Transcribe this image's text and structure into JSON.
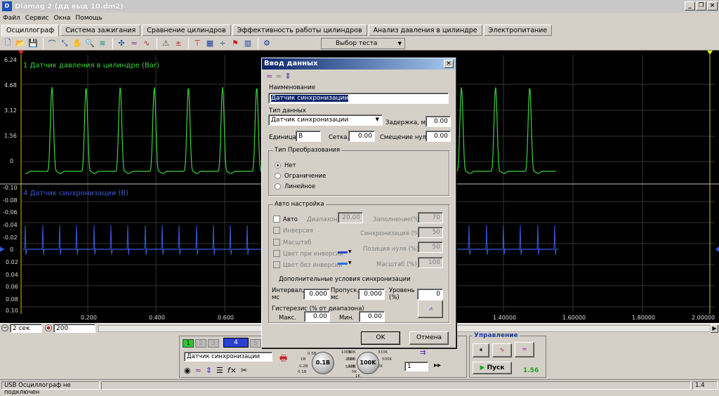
{
  "window": {
    "title": "Diamag 2 (дд выд 10.dm2)",
    "app_icon": "D"
  },
  "menu": [
    "Файл",
    "Сервис",
    "Окна",
    "Помощь"
  ],
  "tabs": [
    "Осциллограф",
    "Система зажигания",
    "Сравнение цилиндров",
    "Эффективность работы цилиндров",
    "Анализ давления в цилиндре",
    "Электропитание"
  ],
  "toolbar": {
    "test_select": "Выбор теста"
  },
  "plot": {
    "ch1_label": "1 Датчик давления в цилиндре (Bar)",
    "ch1_color": "#3ad33a",
    "ch4_label": "4 Датчик синхронизации (В)",
    "ch4_color": "#3a5be0",
    "ch1_ticks": [
      "6.24",
      "4.68",
      "3.12",
      "1.56",
      "0"
    ],
    "ch4_ticks": [
      "-0.10",
      "-0.08",
      "-0.06",
      "-0.04",
      "-0.02",
      "0",
      "0.02",
      "0.04",
      "0.06",
      "0.08",
      "0.10"
    ],
    "x_ticks": [
      "0.200",
      "0.400",
      "0.600",
      "1.40000",
      "1.60000",
      "1.80000",
      "2.00000"
    ]
  },
  "dialog": {
    "title": "Ввод данных",
    "name_label": "Наименование",
    "name_value": "Датчик синхронизации",
    "type_label": "Тип данных",
    "type_value": "Датчик синхронизации",
    "delay_label": "Задержка, мс",
    "delay_value": "0.00",
    "unit_label": "Единица.",
    "unit_value": "В",
    "grid_label": "Сетка.",
    "grid_value": "0.00",
    "zero_label": "Смещение нуля",
    "zero_value": "0.00",
    "conv_group": "Тип Преобразования",
    "conv_options": [
      "Нет",
      "Ограничение",
      "Линейное"
    ],
    "auto_group": "Авто настройка",
    "auto_label": "Авто",
    "range_label": "Диапазон.",
    "range_value": "20.00",
    "inversion_label": "Инверсия",
    "scale_label": "Масштаб",
    "color_inv_label": "Цвет при инверсии",
    "color_noinv_label": "Цвет без инверсии",
    "fill_label": "Заполнение(%)",
    "fill_value": "70",
    "sync_label": "Синхронизация (%)",
    "sync_value": "50",
    "zeropos_label": "Позиция нуля (%)",
    "zeropos_value": "50",
    "scalepct_label": "Масштаб (%)",
    "scalepct_value": "100",
    "extra_label": "Дополнительные условия синхронизации",
    "interval_label": "Интервал, мс",
    "interval_value": "0.000",
    "skip_label": "Пропуск, мс",
    "skip_value": "0.000",
    "level_label": "Уровень (%)",
    "level_value": "0",
    "hyst_label": "Гистерезис (% от диапазона)",
    "max_label": "Макс.",
    "max_value": "0.00",
    "min_label": "Мин.",
    "min_value": "0.00",
    "ok_label": "OK",
    "cancel_label": "Отмена"
  },
  "bottom": {
    "time_value": "2 сек",
    "points_value": "200"
  },
  "panel": {
    "channels": [
      "1",
      "2",
      "3",
      "4",
      "5"
    ],
    "sensor_value": "Датчик синхронизации",
    "knob1": "0.1В",
    "knob1_marks": [
      "10B",
      "20B",
      "50B",
      "100B",
      "200B",
      "500B",
      "1B",
      "0.1B",
      "0.2B",
      "0.5B"
    ],
    "knob2": "100K",
    "knob2_marks": [
      "100K",
      "200K",
      "333K",
      "500K",
      "50K",
      "20K",
      "10K",
      "5K",
      "2K",
      "1K"
    ],
    "spin_value": "1",
    "control_label": "Управление",
    "start_label": "Пуск",
    "value_readout": "1.56"
  },
  "status": {
    "left": "USB Осциллограф не подключен",
    "right": "1.4"
  }
}
